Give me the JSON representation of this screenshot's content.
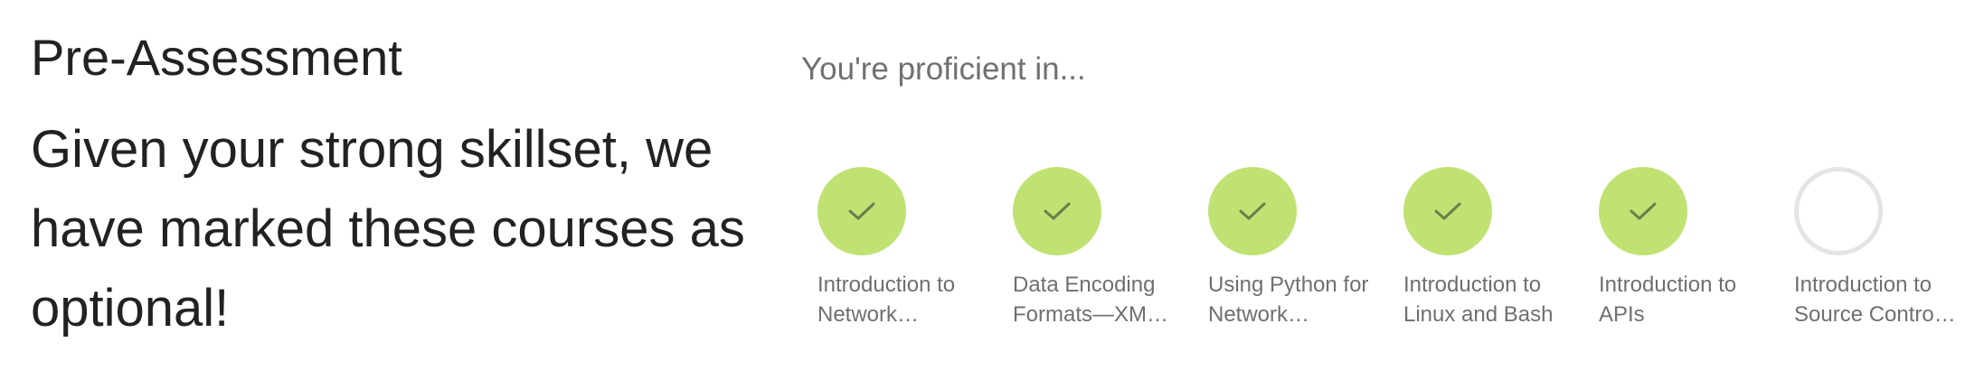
{
  "header": {
    "title": "Pre-Assessment",
    "message": "Given your strong skillset, we have marked these courses as optional!"
  },
  "proficiency": {
    "subtitle": "You're proficient in...",
    "courses": [
      {
        "line1": "Introduction to",
        "line2": "Network…",
        "completed": true,
        "icon": "check-icon"
      },
      {
        "line1": "Data Encoding",
        "line2": "Formats—XM…",
        "completed": true,
        "icon": "check-icon"
      },
      {
        "line1": "Using Python for",
        "line2": "Network…",
        "completed": true,
        "icon": "check-icon"
      },
      {
        "line1": "Introduction to",
        "line2": "Linux and Bash",
        "completed": true,
        "icon": "check-icon"
      },
      {
        "line1": "Introduction to",
        "line2": "APIs",
        "completed": true,
        "icon": "check-icon"
      },
      {
        "line1": "Introduction to",
        "line2": "Source Contro…",
        "completed": false,
        "icon": "empty-circle"
      }
    ]
  },
  "colors": {
    "completed": "#bfe273",
    "pending_border": "#e4e4e4",
    "check": "#6b7d4a"
  }
}
